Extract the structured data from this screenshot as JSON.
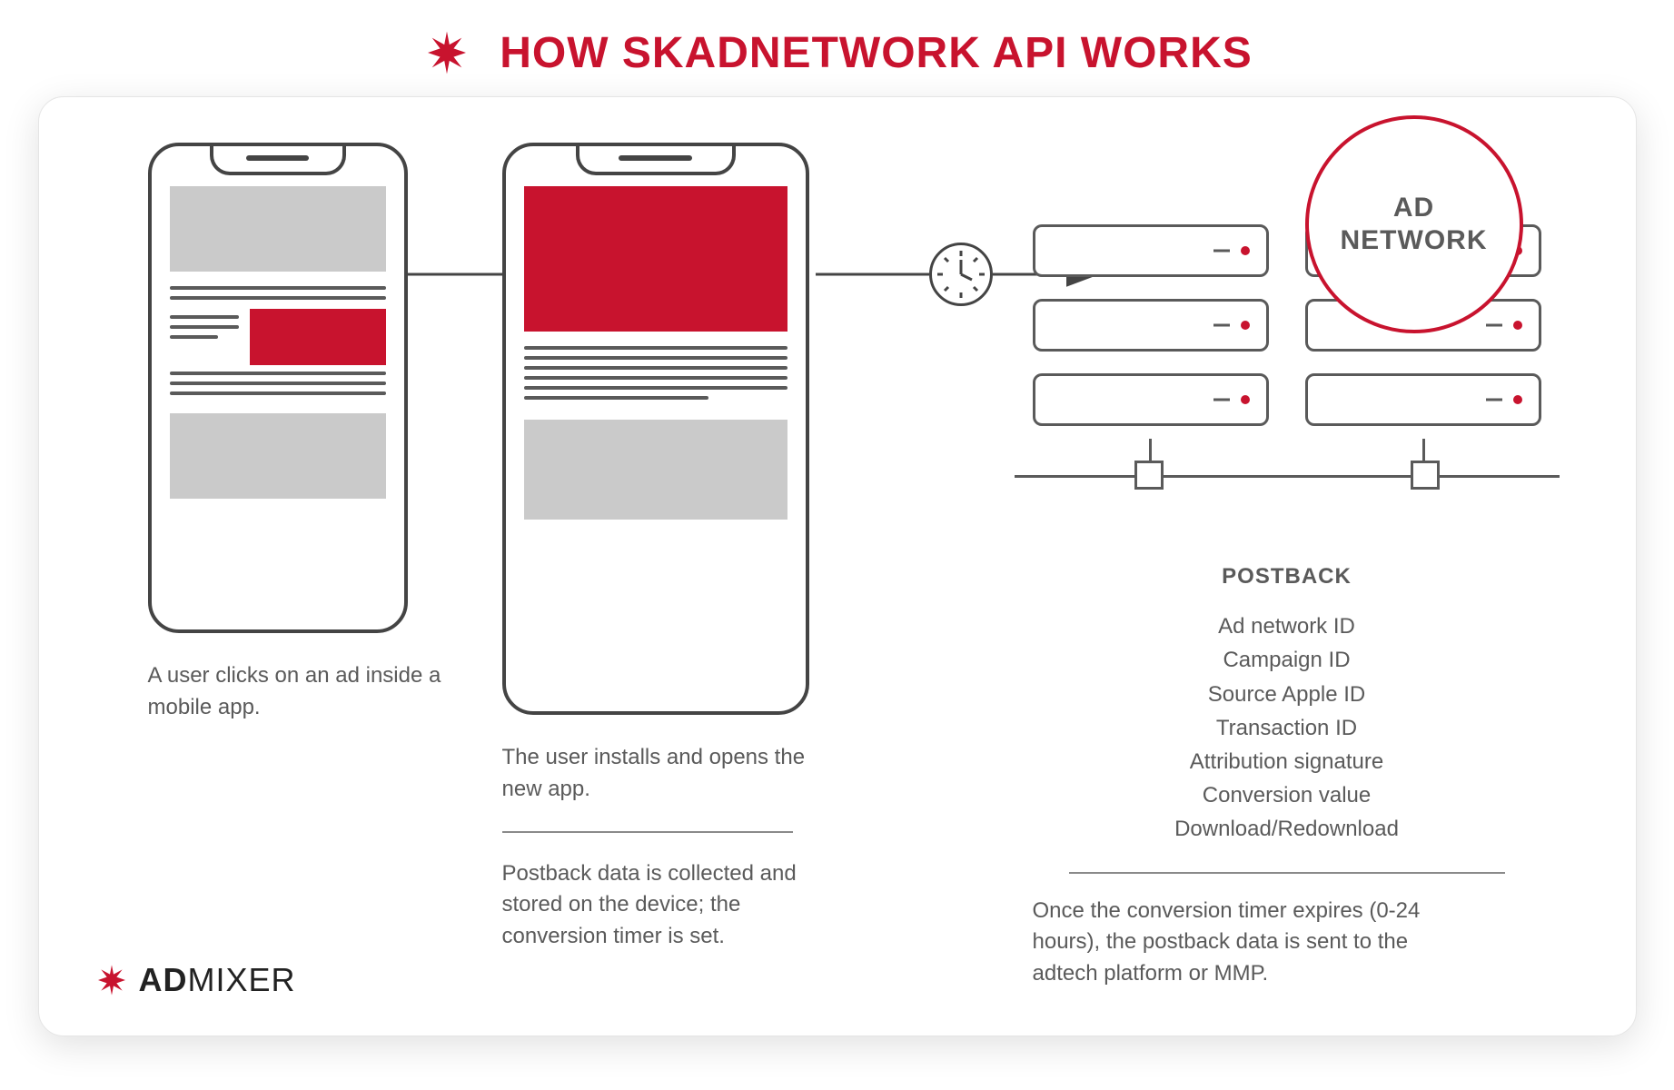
{
  "title": "HOW SKADNETWORK API WORKS",
  "stage1": {
    "caption": "A user clicks on an ad inside a mobile app."
  },
  "stage2": {
    "caption1": "The user installs and opens the new app.",
    "caption2": "Postback data is collected and stored on the device; the conversion timer is set."
  },
  "network": {
    "label": "AD\nNETWORK"
  },
  "postback": {
    "title": "POSTBACK",
    "items": [
      "Ad network ID",
      "Campaign ID",
      "Source Apple ID",
      "Transaction ID",
      "Attribution signature",
      "Conversion value",
      "Download/Redownload"
    ],
    "caption": "Once the conversion timer expires (0-24 hours), the postback data is sent to the adtech platform or MMP."
  },
  "logo": {
    "brand": "AD",
    "brand2": "MIXER"
  },
  "colors": {
    "accent": "#C8132E",
    "gray": "#5a5a5a"
  }
}
